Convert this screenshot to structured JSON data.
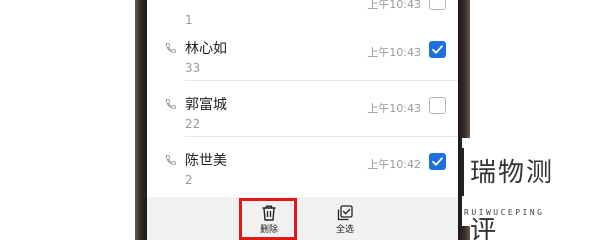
{
  "contacts": [
    {
      "name": "",
      "count": "1",
      "time": "上午10:43",
      "checked": false
    },
    {
      "name": "林心如",
      "count": "33",
      "time": "上午10:43",
      "checked": true
    },
    {
      "name": "郭富城",
      "count": "22",
      "time": "上午10:43",
      "checked": false
    },
    {
      "name": "陈世美",
      "count": "2",
      "time": "上午10:42",
      "checked": true
    }
  ],
  "bottom_bar": {
    "delete_label": "删除",
    "select_all_label": "全选"
  },
  "watermark": {
    "chars": "瑞物测评",
    "sub": "RUIWUCEPING"
  },
  "colors": {
    "accent": "#1f6fe0",
    "highlight": "#e01818"
  }
}
